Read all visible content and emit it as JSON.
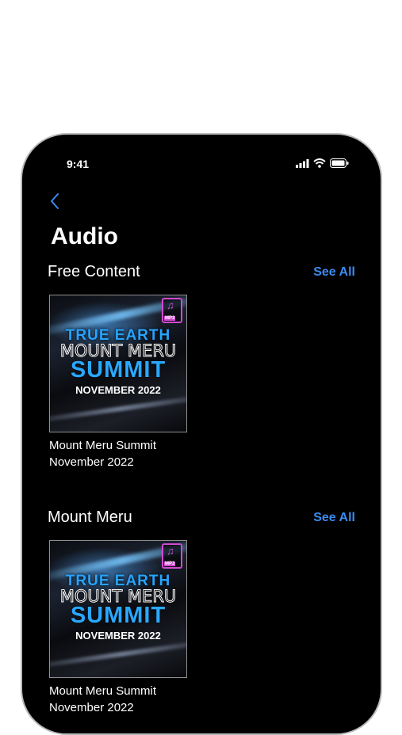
{
  "status": {
    "time": "9:41"
  },
  "nav": {
    "back_icon": "chevron-left-icon",
    "title": "Audio"
  },
  "colors": {
    "accent": "#3b8bf0",
    "background": "#000000"
  },
  "sections": [
    {
      "title": "Free Content",
      "see_all": "See All",
      "items": [
        {
          "title": "Mount Meru Summit November 2022",
          "artwork": {
            "line1": "TRUE EARTH",
            "line2": "MOUNT MERU",
            "line3": "SUMMIT",
            "line4": "NOVEMBER 2022",
            "badge": "MP3"
          }
        }
      ]
    },
    {
      "title": "Mount Meru",
      "see_all": "See All",
      "items": [
        {
          "title": "Mount Meru Summit November 2022",
          "artwork": {
            "line1": "TRUE EARTH",
            "line2": "MOUNT MERU",
            "line3": "SUMMIT",
            "line4": "NOVEMBER 2022",
            "badge": "MP3"
          }
        }
      ]
    }
  ]
}
